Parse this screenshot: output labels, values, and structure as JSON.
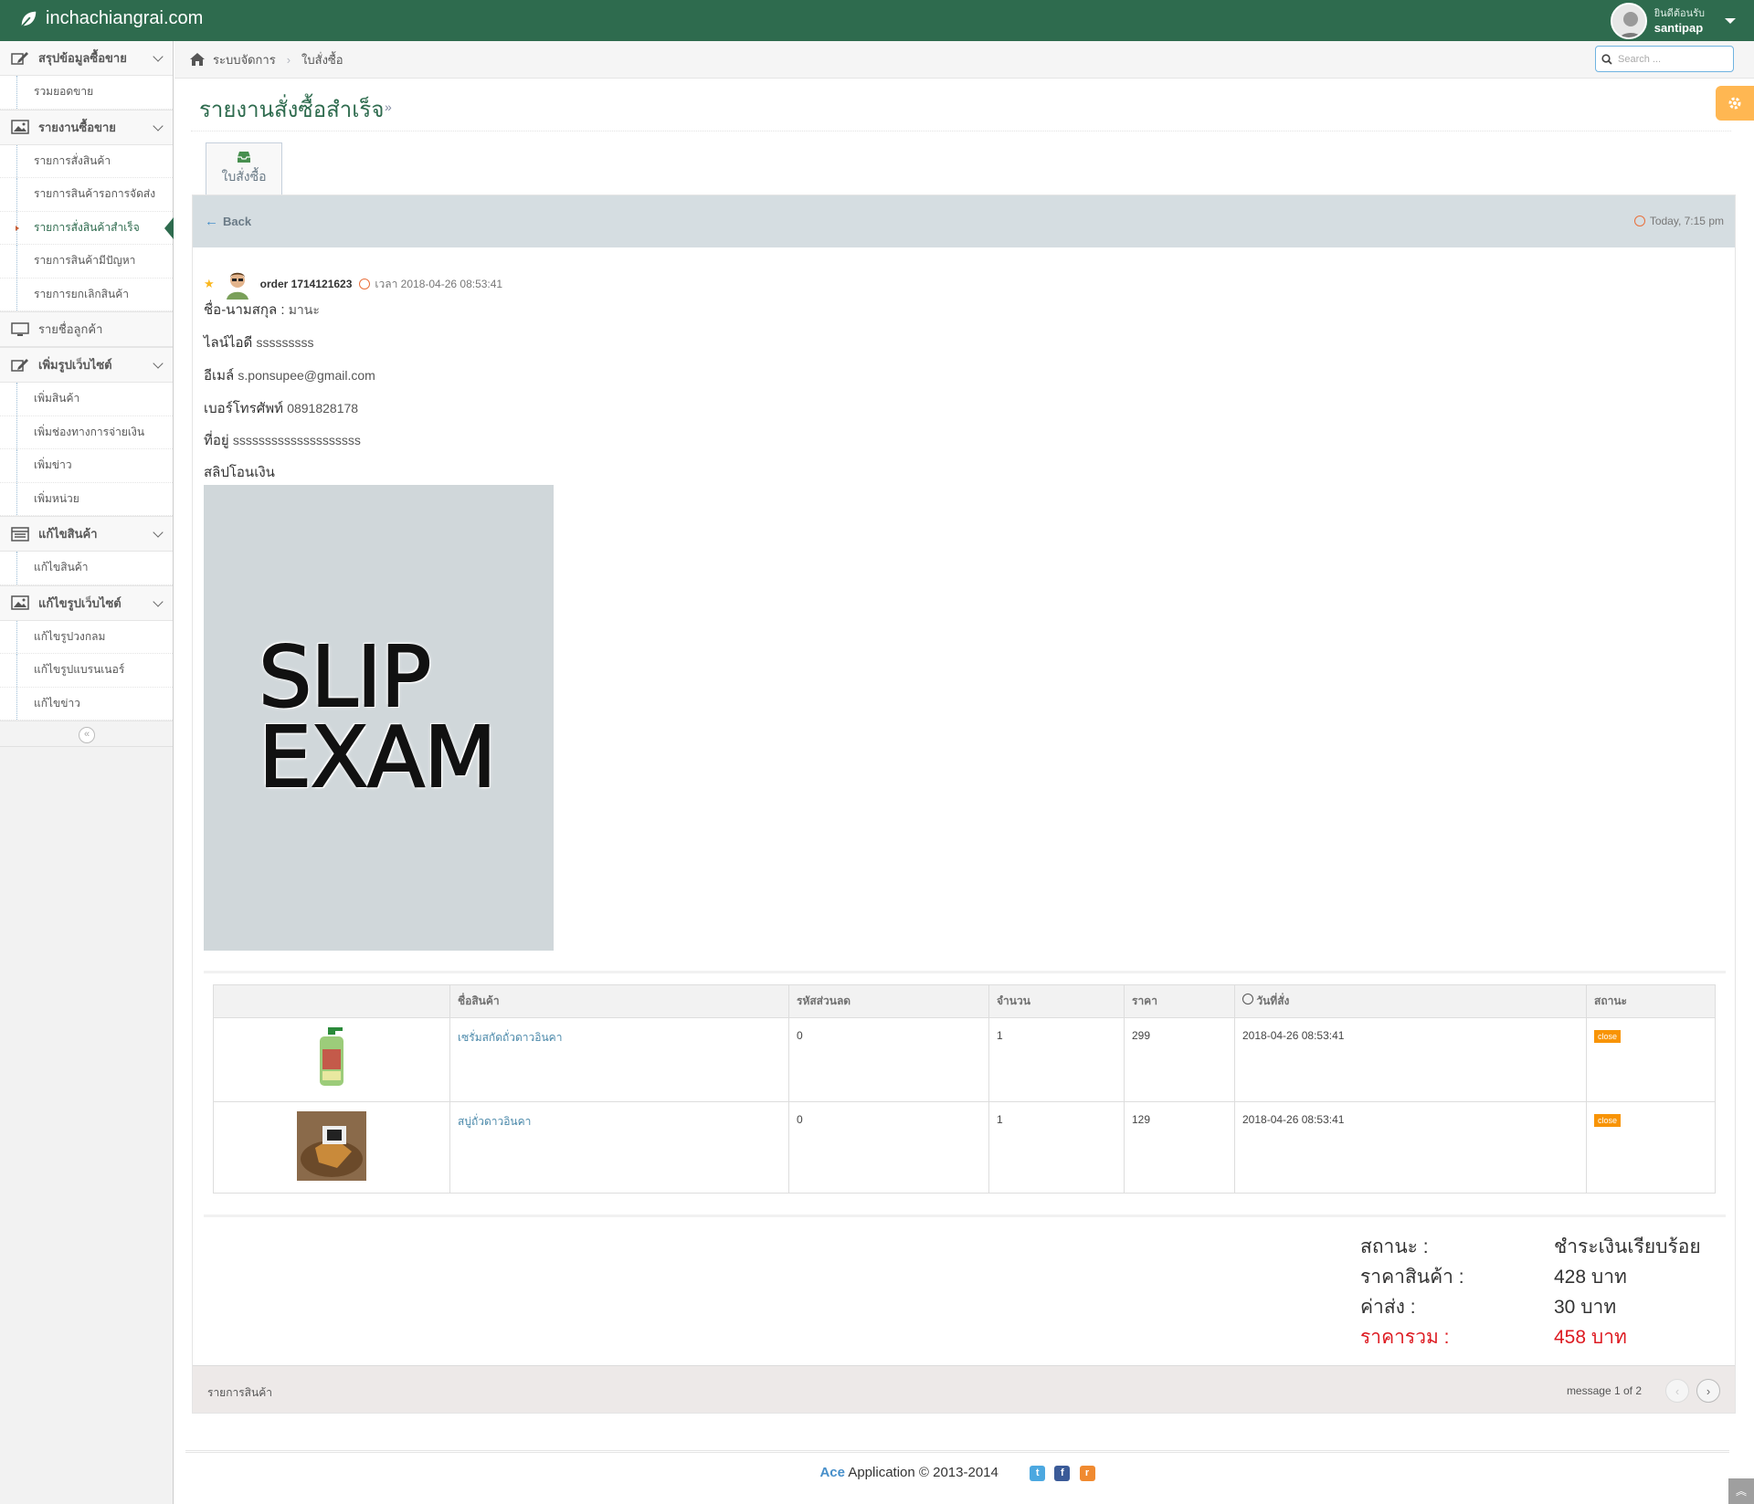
{
  "navbar": {
    "brand": "inchachiangrai.com",
    "welcome": "ยินดีต้อนรับ",
    "username": "santipap"
  },
  "sidebar": {
    "groups": [
      {
        "label": "สรุปข้อมูลซื้อขาย",
        "items": [
          "รวมยอดขาย"
        ]
      },
      {
        "label": "รายงานซื้อขาย",
        "items": [
          "รายการสั่งสินค้า",
          "รายการสินค้ารอการจัดส่ง",
          "รายการสั่งสินค้าสำเร็จ",
          "รายการสินค้ามีปัญหา",
          "รายการยกเลิกสินค้า"
        ]
      },
      {
        "label": "รายชื่อลูกค้า",
        "items": []
      },
      {
        "label": "เพิ่มรูปเว็บไซต์",
        "items": [
          "เพิ่มสินค้า",
          "เพิ่มช่องทางการจ่ายเงิน",
          "เพิ่มข่าว",
          "เพิ่มหน่วย"
        ]
      },
      {
        "label": "แก้ไขสินค้า",
        "items": [
          "แก้ไขสินค้า"
        ]
      },
      {
        "label": "แก้ไขรูปเว็บไซต์",
        "items": [
          "แก้ไขรูปวงกลม",
          "แก้ไขรูปแบรนเนอร์",
          "แก้ไขข่าว"
        ]
      }
    ]
  },
  "breadcrumb": {
    "home": "ระบบจัดการ",
    "current": "ใบสั่งซื้อ"
  },
  "search": {
    "placeholder": "Search ..."
  },
  "page": {
    "title": "รายงานสั่งซื้อสำเร็จ",
    "title_arrow": "»"
  },
  "tab": {
    "label": "ใบสั่งซื้อ"
  },
  "panel": {
    "back_label": "Back",
    "today": "Today, 7:15 pm"
  },
  "order": {
    "id": "order 1714121623",
    "time": "เวลา 2018-04-26 08:53:41",
    "fields": [
      {
        "label": "ชื่อ-นามสกุล :",
        "value": "มานะ"
      },
      {
        "label": "ไลน์ไอดี",
        "value": "sssssssss"
      },
      {
        "label": "อีเมล์",
        "value": "s.ponsupee@gmail.com"
      },
      {
        "label": "เบอร์โทรศัพท์",
        "value": "0891828178"
      },
      {
        "label": "ที่อยู่",
        "value": "ssssssssssssssssssss"
      }
    ],
    "slip_label": "สลิปโอนเงิน",
    "slip_text_1": "SLIP",
    "slip_text_2": "EXAM"
  },
  "table": {
    "headers": [
      "",
      "ชื่อสินค้า",
      "รหัสส่วนลด",
      "จำนวน",
      "ราคา",
      "วันที่สั่ง",
      "สถานะ"
    ],
    "rows": [
      {
        "name": "เซรั่มสกัดถั่วดาวอินคา",
        "discount": "0",
        "qty": "1",
        "price": "299",
        "date": "2018-04-26 08:53:41",
        "status": "close"
      },
      {
        "name": "สบู่ถั่วดาวอินคา",
        "discount": "0",
        "qty": "1",
        "price": "129",
        "date": "2018-04-26 08:53:41",
        "status": "close"
      }
    ]
  },
  "summary": [
    {
      "label": "สถานะ :",
      "value": "ชำระเงินเรียบร้อย"
    },
    {
      "label": "ราคาสินค้า :",
      "value": "428 บาท"
    },
    {
      "label": "ค่าส่ง :",
      "value": "30 บาท"
    },
    {
      "label": "ราคารวม :",
      "value": "458 บาท"
    }
  ],
  "panel_footer": {
    "left": "รายการสินค้า",
    "message": "message 1 of 2"
  },
  "footer": {
    "ace": "Ace",
    "text": " Application © 2013-2014"
  },
  "colors": {
    "navbar": "#2e6b4e",
    "title": "#2e6b4e",
    "badge": "#f89406",
    "total": "#dd1a21",
    "settings": "#ffb752"
  }
}
